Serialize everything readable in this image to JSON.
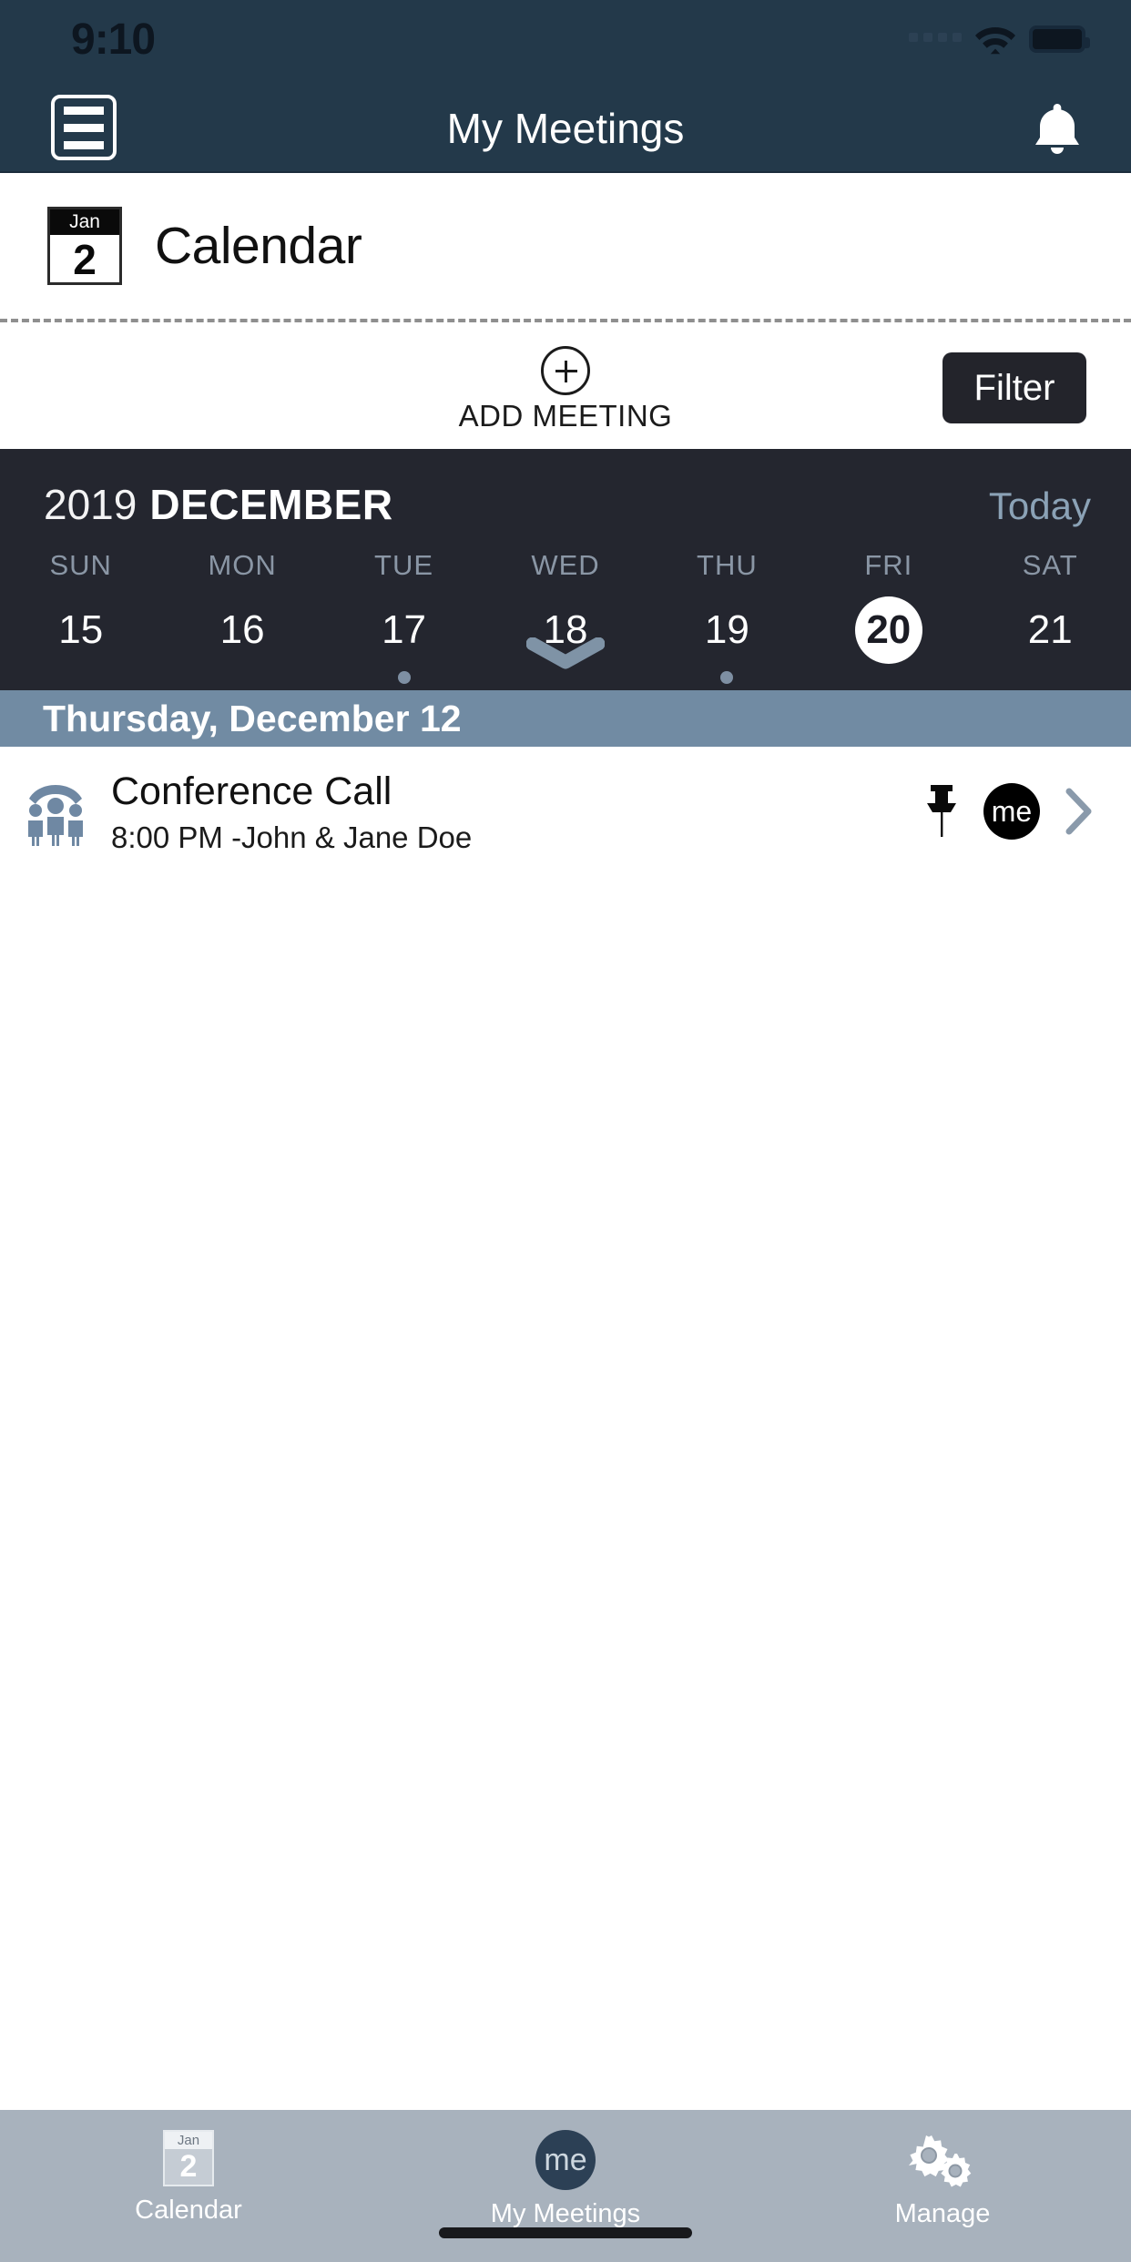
{
  "status_bar": {
    "time": "9:10",
    "icons": [
      "signal-dots-icon",
      "wifi-icon",
      "battery-icon"
    ]
  },
  "nav": {
    "menu_icon": "hamburger-menu-icon",
    "title": "My Meetings",
    "notification_icon": "bell-icon"
  },
  "page_head": {
    "icon_month": "Jan",
    "icon_day": "2",
    "title": "Calendar"
  },
  "actions": {
    "add_meeting_label": "ADD MEETING",
    "add_icon": "plus-circle-icon",
    "filter_label": "Filter"
  },
  "calendar": {
    "year": "2019",
    "month": "DECEMBER",
    "today_label": "Today",
    "expand_icon": "chevron-down-icon",
    "days": [
      {
        "dow": "SUN",
        "num": "15",
        "selected": false,
        "has_event": false
      },
      {
        "dow": "MON",
        "num": "16",
        "selected": false,
        "has_event": false
      },
      {
        "dow": "TUE",
        "num": "17",
        "selected": false,
        "has_event": true
      },
      {
        "dow": "WED",
        "num": "18",
        "selected": false,
        "has_event": false
      },
      {
        "dow": "THU",
        "num": "19",
        "selected": false,
        "has_event": true
      },
      {
        "dow": "FRI",
        "num": "20",
        "selected": true,
        "has_event": false
      },
      {
        "dow": "SAT",
        "num": "21",
        "selected": false,
        "has_event": false
      }
    ]
  },
  "agenda": {
    "section_date": "Thursday, December 12",
    "meetings": [
      {
        "icon": "conference-call-icon",
        "title": "Conference Call",
        "subtitle": "8:00 PM -John & Jane Doe",
        "pin_icon": "pushpin-icon",
        "badge_text": "me",
        "chevron_icon": "chevron-right-icon"
      }
    ]
  },
  "tabbar": {
    "tabs": [
      {
        "label": "Calendar",
        "icon": "calendar-icon",
        "icon_month": "Jan",
        "icon_day": "2",
        "active": false
      },
      {
        "label": "My Meetings",
        "icon": "me-badge-icon",
        "badge_text": "me",
        "active": true
      },
      {
        "label": "Manage",
        "icon": "gears-icon",
        "active": false
      }
    ]
  },
  "colors": {
    "header_bg": "#23394a",
    "calendar_strip_bg": "#24262f",
    "date_band_bg": "#718ba3",
    "filter_btn_bg": "#23242b",
    "tabbar_bg": "#a8b2bd",
    "accent_muted": "#8ba2b6",
    "event_dot": "#7e8fa3"
  }
}
